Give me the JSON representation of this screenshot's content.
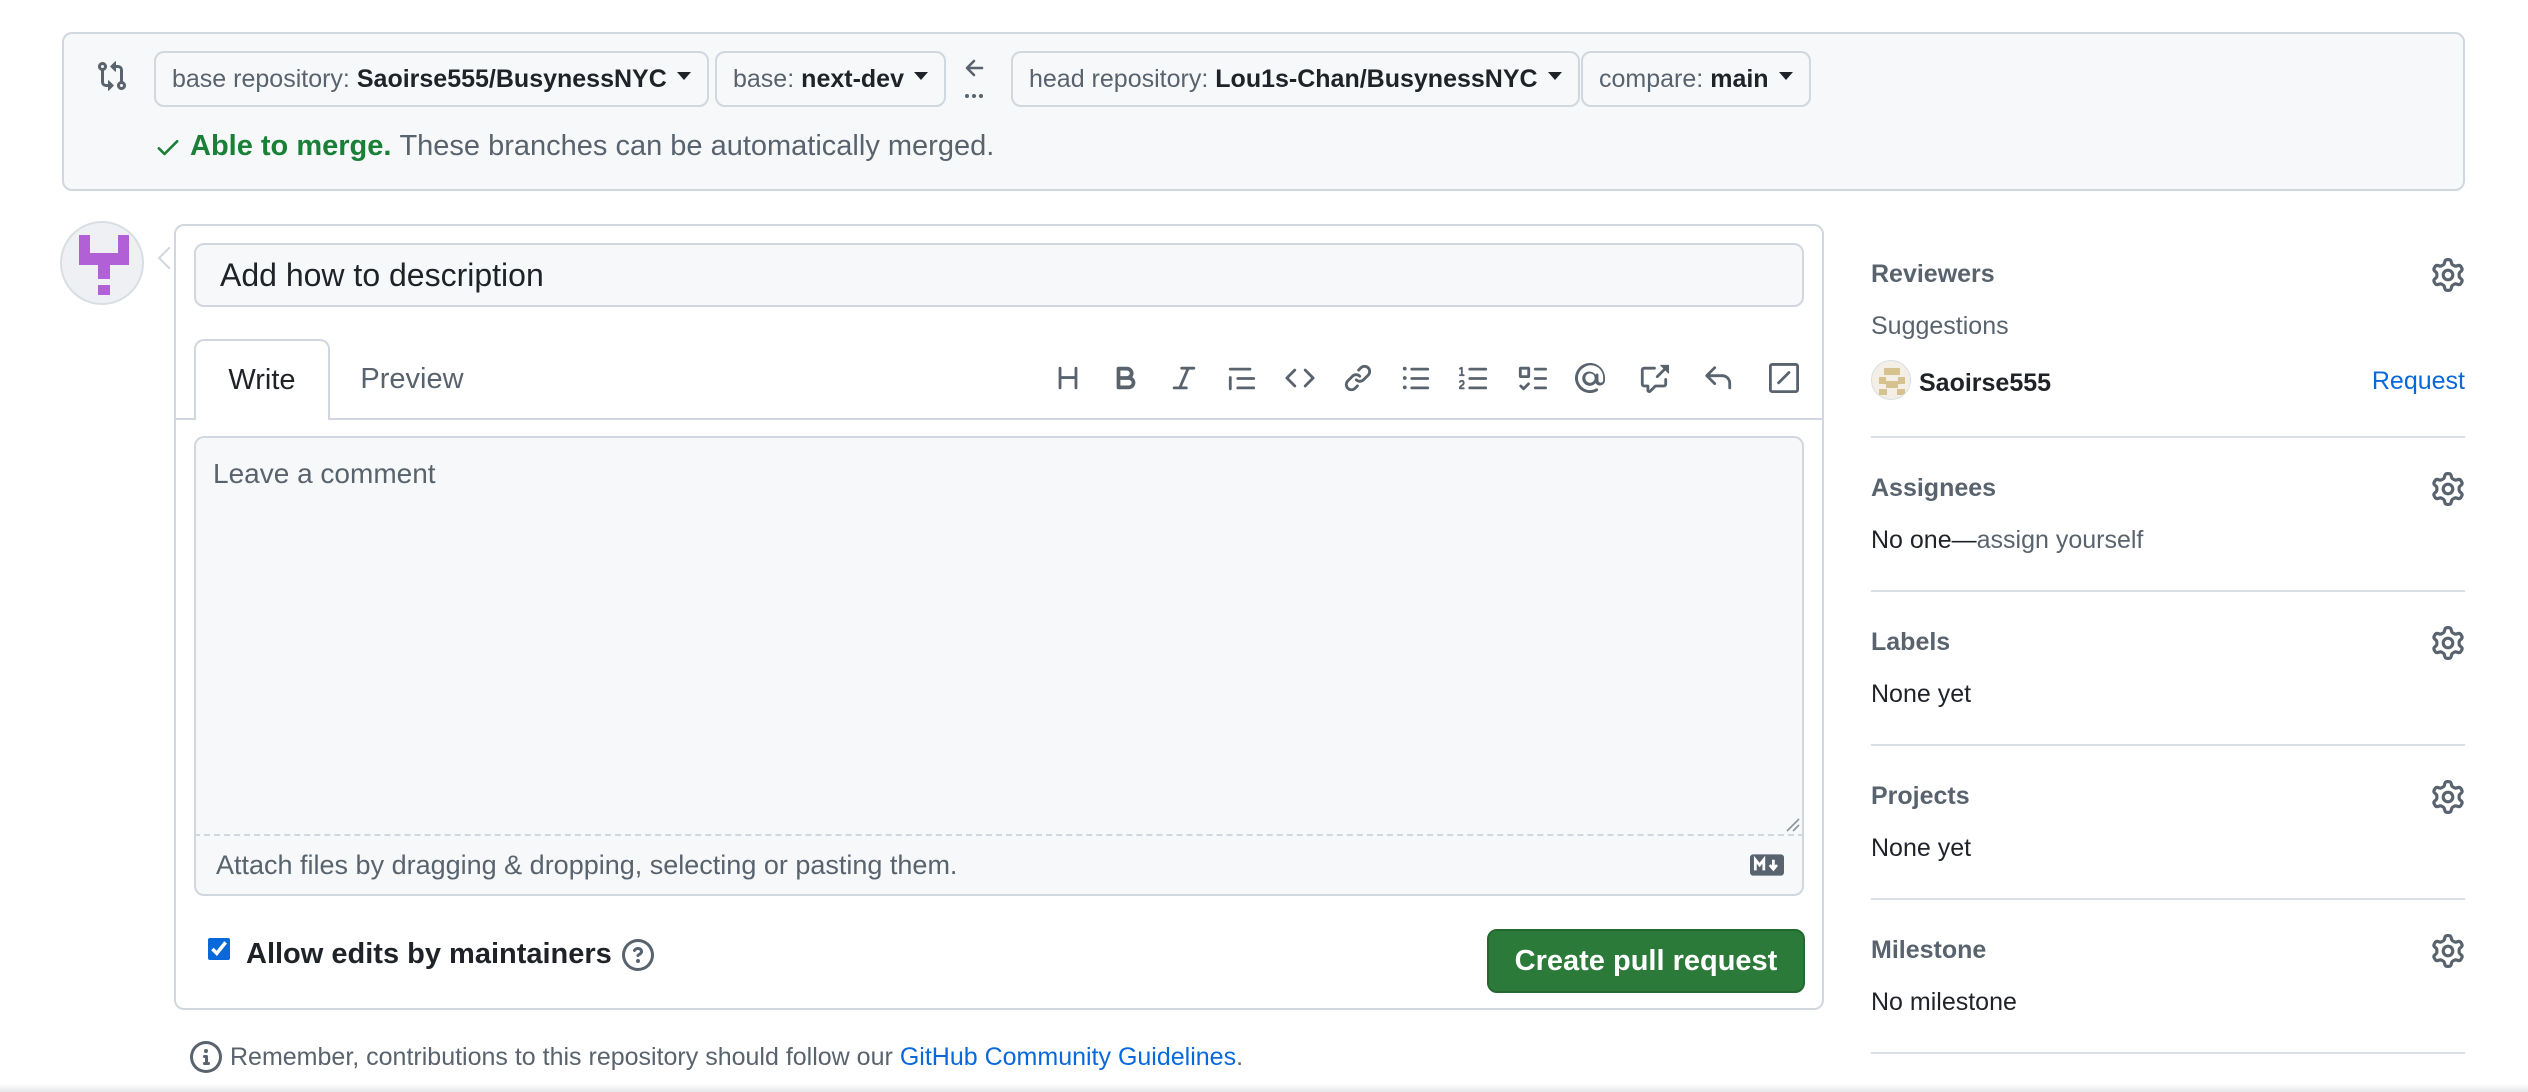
{
  "compare": {
    "base_repo_prefix": "base repository:",
    "base_repo_value": "Saoirse555/BusynessNYC",
    "base_prefix": "base:",
    "base_value": "next-dev",
    "head_repo_prefix": "head repository:",
    "head_repo_value": "Lou1s-Chan/BusynessNYC",
    "compare_prefix": "compare:",
    "compare_value": "main",
    "merge_ok": "Able to merge.",
    "merge_msg": "These branches can be automatically merged."
  },
  "form": {
    "title_value": "Add how to description",
    "tabs": [
      "Write",
      "Preview"
    ],
    "comment_placeholder": "Leave a comment",
    "attach_text": "Attach files by dragging & dropping, selecting or pasting them.",
    "allow_edits_label": "Allow edits by maintainers",
    "allow_edits_checked": true,
    "create_button": "Create pull request"
  },
  "footer": {
    "remember_text": "Remember, contributions to this repository should follow our",
    "link_text": "GitHub Community Guidelines",
    "period": "."
  },
  "sidebar": {
    "reviewers_title": "Reviewers",
    "suggestions": "Suggestions",
    "reviewer_name": "Saoirse555",
    "request_label": "Request",
    "assignees_title": "Assignees",
    "assignees_none": "No one—",
    "assign_yourself": "assign yourself",
    "labels_title": "Labels",
    "labels_value": "None yet",
    "projects_title": "Projects",
    "projects_value": "None yet",
    "milestone_title": "Milestone",
    "milestone_value": "No milestone"
  },
  "colors": {
    "accent_blue": "#0969da",
    "success_green": "#1a7f37",
    "button_green": "#2c7a3a",
    "avatar_purple": "#b260d6"
  },
  "icons": [
    "git-compare-icon",
    "arrow-left-icon",
    "check-icon",
    "heading-icon",
    "bold-icon",
    "italic-icon",
    "quote-icon",
    "code-icon",
    "link-icon",
    "unordered-list-icon",
    "ordered-list-icon",
    "task-list-icon",
    "mention-icon",
    "cross-reference-icon",
    "reply-icon",
    "slash-command-icon",
    "markdown-icon",
    "question-icon",
    "info-icon",
    "gear-icon"
  ]
}
